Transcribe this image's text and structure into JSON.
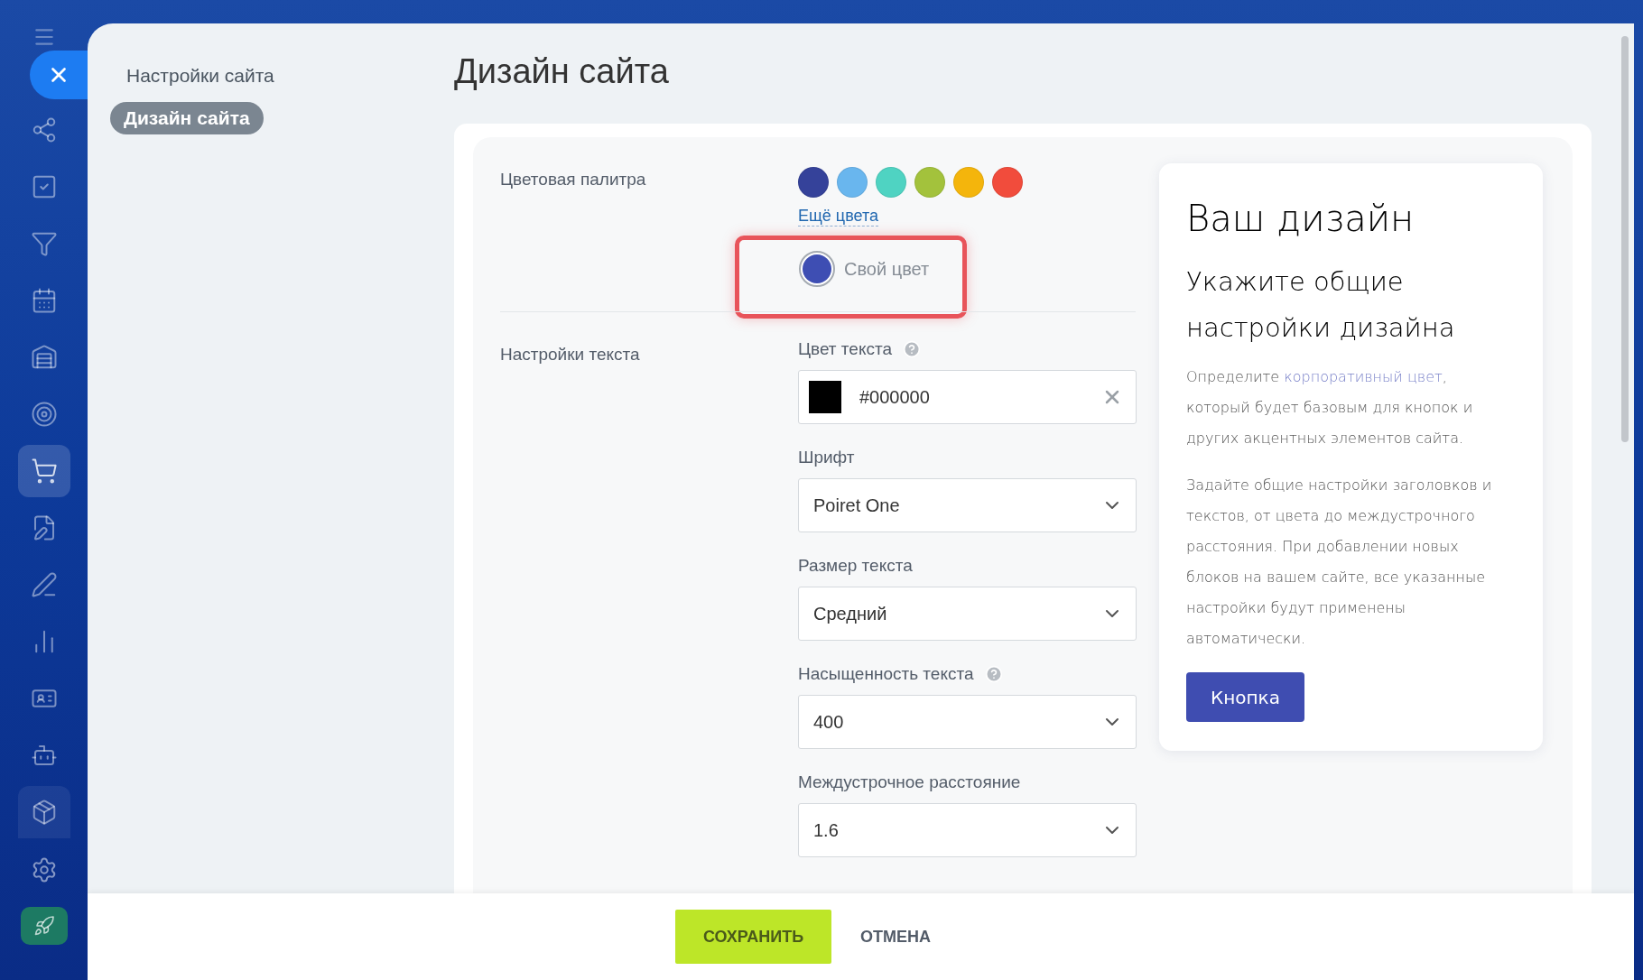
{
  "sidebar": {
    "items": [
      {
        "selected": false,
        "hovered": false
      },
      {
        "selected": false,
        "hovered": false
      },
      {
        "selected": false,
        "hovered": false
      },
      {
        "selected": false,
        "hovered": false
      },
      {
        "selected": false,
        "hovered": false
      },
      {
        "selected": false,
        "hovered": false
      },
      {
        "selected": true,
        "hovered": false
      },
      {
        "selected": false,
        "hovered": false
      },
      {
        "selected": false,
        "hovered": false
      },
      {
        "selected": false,
        "hovered": false
      },
      {
        "selected": false,
        "hovered": false
      },
      {
        "selected": false,
        "hovered": false
      },
      {
        "selected": false,
        "hovered": true
      }
    ]
  },
  "nav": {
    "title": "Настройки сайта",
    "items": [
      {
        "label": "Дизайн сайта",
        "selected": true
      }
    ]
  },
  "page": {
    "title": "Дизайн сайта"
  },
  "palette": {
    "label": "Цветовая палитра",
    "swatches": [
      {
        "color": "#35429a",
        "selected": false
      },
      {
        "color": "#69b6ee",
        "selected": false
      },
      {
        "color": "#4fd3c2",
        "selected": false
      },
      {
        "color": "#a3c23c",
        "selected": false
      },
      {
        "color": "#f4b50c",
        "selected": false
      },
      {
        "color": "#f14c3c",
        "selected": false
      }
    ],
    "more_link": "Ещё цвета",
    "custom": {
      "label": "Свой цвет",
      "color": "#3e4eb3",
      "selected": true,
      "highlighted": true
    }
  },
  "text_settings": {
    "label": "Настройки текста",
    "fields": [
      {
        "kind": "color",
        "label": "Цвет текста",
        "help": true,
        "value": "#000000"
      },
      {
        "kind": "select",
        "label": "Шрифт",
        "help": false,
        "value": "Poiret One"
      },
      {
        "kind": "select",
        "label": "Размер текста",
        "help": false,
        "value": "Средний"
      },
      {
        "kind": "select",
        "label": "Насыщенность текста",
        "help": true,
        "value": "400"
      },
      {
        "kind": "select",
        "label": "Междустрочное расстояние",
        "help": false,
        "value": "1.6"
      }
    ]
  },
  "preview": {
    "heading": "Ваш дизайн",
    "subheading": "Укажите общие настройки дизайна",
    "intro": {
      "before": "Определите ",
      "link": "корпоративный цвет",
      "after": ", который будет базовым для кнопок и других акцентных элементов сайта."
    },
    "paragraph": "Задайте общие настройки заголовков и текстов, от цвета до междустрочного расстояния. При добавлении новых блоков на вашем сайте, все указанные настройки будут применены автоматически.",
    "button": "Кнопка"
  },
  "footer": {
    "buttons": [
      {
        "label": "СОХРАНИТЬ",
        "kind": "primary"
      },
      {
        "label": "ОТМЕНА",
        "kind": "secondary"
      }
    ]
  }
}
